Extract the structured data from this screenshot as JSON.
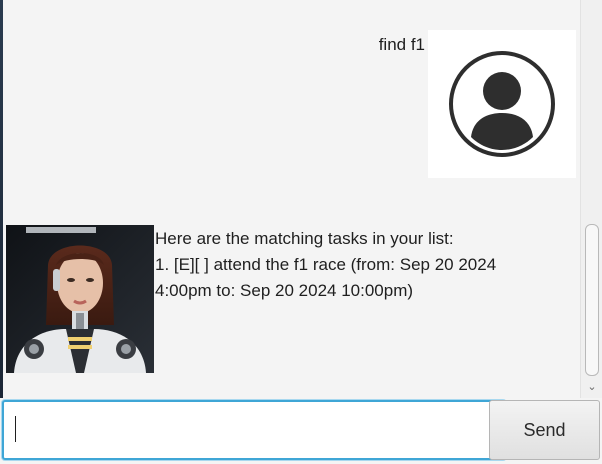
{
  "chat": {
    "user_message": {
      "text": "find f1",
      "avatar_icon": "user-circle-icon"
    },
    "bot_message": {
      "lines": [
        "Here are the matching tasks in your list:",
        "1. [E][ ] attend the f1 race (from: Sep 20 2024",
        "4:00pm to: Sep 20 2024 10:00pm)"
      ],
      "avatar": "robot-woman-portrait"
    }
  },
  "input": {
    "value": "",
    "placeholder": ""
  },
  "send_button": {
    "label": "Send"
  },
  "colors": {
    "background": "#f4f4f4",
    "input_focus_border": "#3fa6d6",
    "user_icon": "#2e2e2e"
  }
}
